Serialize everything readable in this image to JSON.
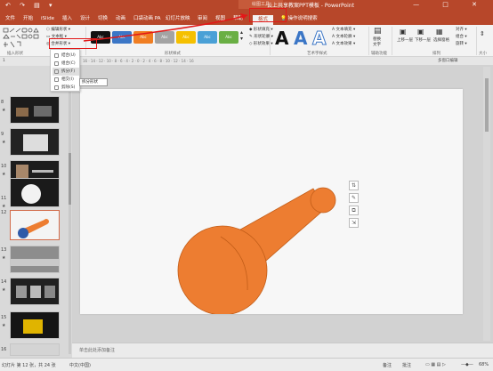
{
  "titlebar": {
    "contextual_tab": "绘图工具",
    "doc_title": "云上共享教案PPT模板 - PowerPoint",
    "quick_access": "↶ ↷ ▤ ▾",
    "window_controls": "— □ ✕"
  },
  "tabs": [
    {
      "label": "文件"
    },
    {
      "label": "开始"
    },
    {
      "label": "iSlide"
    },
    {
      "label": "插入"
    },
    {
      "label": "设计"
    },
    {
      "label": "切换"
    },
    {
      "label": "动画"
    },
    {
      "label": "口袋动画 PA"
    },
    {
      "label": "幻灯片放映"
    },
    {
      "label": "审阅"
    },
    {
      "label": "视图"
    },
    {
      "label": "帮助"
    },
    {
      "label": "格式"
    },
    {
      "label": "操作说明搜索"
    }
  ],
  "ribbon": {
    "insert_shapes_label": "插入形状",
    "edit_shape": "编辑形状 ▾",
    "text_box": "文本框 ▾",
    "merge_shapes": "合并形状 ▾",
    "shape_styles_label": "形状样式",
    "swatches": [
      {
        "text": "Abc",
        "color": "#111111"
      },
      {
        "text": "Abc",
        "color": "#3b76c6"
      },
      {
        "text": "Abc",
        "color": "#f07e22"
      },
      {
        "text": "Abc",
        "color": "#a3a3a3"
      },
      {
        "text": "Abc",
        "color": "#f5c000"
      },
      {
        "text": "Abc",
        "color": "#4aa0d6"
      },
      {
        "text": "Abc",
        "color": "#6aaf44"
      }
    ],
    "shape_fill": "形状填充 ▾",
    "shape_outline": "形状轮廓 ▾",
    "shape_effects": "形状效果 ▾",
    "wordart_label": "艺术字样式",
    "wordart_letters": [
      "A",
      "A",
      "A"
    ],
    "text_fill": "文本填充 ▾",
    "text_outline": "文本轮廓 ▾",
    "text_effects": "文本效果 ▾",
    "accessibility_label": "辅助功能",
    "alt_text": "替换\n文字",
    "bring_forward": "上移一层",
    "send_backward": "下移一层",
    "selection_pane": "选择窗格",
    "align": "对齐 ▾",
    "group": "组合 ▾",
    "rotate": "旋转 ▾",
    "arrange_label": "排列",
    "size_label": "大小"
  },
  "merge_menu": {
    "items": [
      {
        "label": "结合(U)"
      },
      {
        "label": "组合(C)"
      },
      {
        "label": "拆分(F)"
      },
      {
        "label": "相交(I)"
      },
      {
        "label": "剪除(S)"
      }
    ],
    "tooltip": "拆分形状"
  },
  "thumbnails": [
    {
      "number": "8"
    },
    {
      "number": "9"
    },
    {
      "number": "10"
    },
    {
      "number": "11"
    },
    {
      "number": "12"
    },
    {
      "number": "13"
    },
    {
      "number": "14"
    },
    {
      "number": "15"
    },
    {
      "number": "16"
    }
  ],
  "editor": {
    "ruler_text": "16 · 14 · 12 · 10 · 8 · 6 · 4 · 2 · 0 · 2 · 4 · 6 · 8 · 10 · 12 · 14 · 16",
    "notes_placeholder": "单击此处添加备注",
    "shape_color": "#ed7d31",
    "multi_label": "多窗口编辑"
  },
  "statusbar": {
    "slide_counter": "幻灯片 第 12 张，共 24 张",
    "language": "中文(中国)",
    "notes": "备注",
    "comments": "批注",
    "zoom": "68%"
  }
}
